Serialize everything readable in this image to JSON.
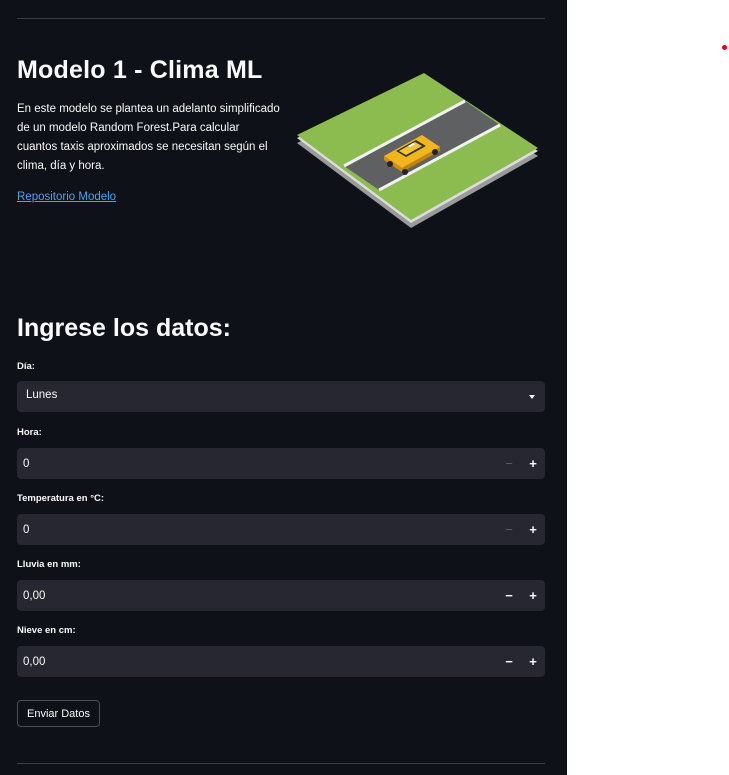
{
  "header": {
    "title": "Modelo 1 - Clima ML",
    "description": "En este modelo se plantea un adelanto simplificado de un modelo Random Forest.Para calcular cuantos taxis aproximados se necesitan según el clima, día y hora.",
    "repo_link": "Repositorio Modelo",
    "illustration": "taxi-on-road-illustration"
  },
  "form": {
    "title": "Ingrese los datos:",
    "dia": {
      "label": "Día:",
      "value": "Lunes"
    },
    "hora": {
      "label": "Hora:",
      "value": "0",
      "minus": "−",
      "plus": "+"
    },
    "temperatura": {
      "label": "Temperatura en °C:",
      "value": "0",
      "minus": "−",
      "plus": "+"
    },
    "lluvia": {
      "label": "Lluvia en mm:",
      "value": "0,00",
      "minus": "−",
      "plus": "+"
    },
    "nieve": {
      "label": "Nieve en cm:",
      "value": "0,00",
      "minus": "−",
      "plus": "+"
    },
    "submit_label": "Enviar Datos"
  },
  "colors": {
    "background": "#0e1117",
    "input_bg": "#262730",
    "link": "#4ea3f1",
    "status_dot": "#e8000b"
  }
}
